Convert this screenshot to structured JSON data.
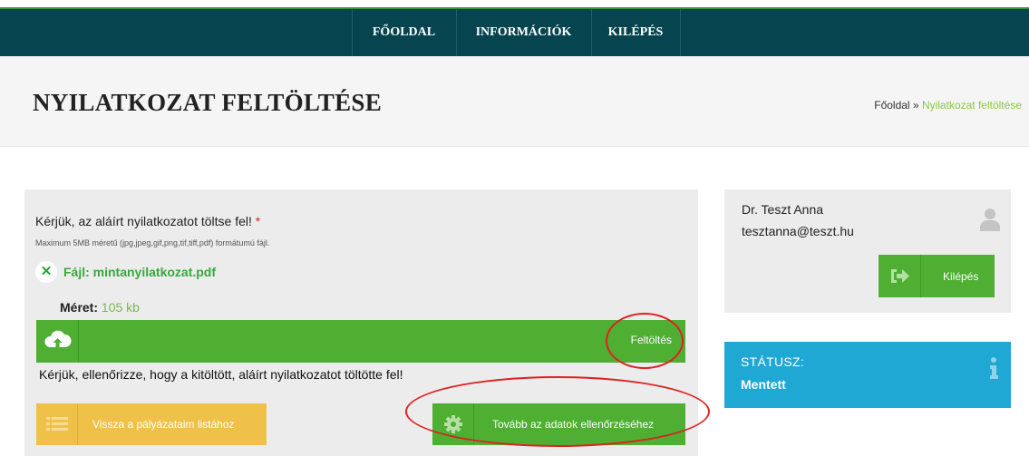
{
  "nav": {
    "items": [
      {
        "label": "FŐOLDAL"
      },
      {
        "label": "INFORMÁCIÓK"
      },
      {
        "label": "KILÉPÉS"
      }
    ]
  },
  "header": {
    "title": "NYILATKOZAT FELTÖLTÉSE",
    "breadcrumb": {
      "home": "Főoldal",
      "separator": " » ",
      "current": "Nyilatkozat feltöltése"
    }
  },
  "upload_form": {
    "label": "Kérjük, az aláírt nyilatkozatot töltse fel!",
    "required_mark": "*",
    "hint": "Maximum 5MB méretű (jpg,jpeg,gif,png,tif,tiff,pdf) formátumú fájl.",
    "file_label": "Fájl: mintanyilatkozat.pdf",
    "remove_icon": "close-icon",
    "size_label": "Méret:",
    "size_value": "105 kb",
    "upload_button": "Feltöltés",
    "upload_icon": "cloud-upload-icon",
    "notice": "Kérjük, ellenőrizze, hogy a kitöltött, aláírt nyilatkozatot töltötte fel!",
    "back_button": "Vissza a pályázataim listához",
    "back_icon": "list-icon",
    "next_button": "Tovább az adatok ellenőrzéséhez",
    "next_icon": "gear-icon"
  },
  "user": {
    "name": "Dr. Teszt Anna",
    "email": "tesztanna@teszt.hu",
    "avatar_icon": "user-icon",
    "logout_button": "Kilépés",
    "logout_icon": "sign-out-icon"
  },
  "status": {
    "title": "STÁTUSZ:",
    "value": "Mentett",
    "icon": "info-icon"
  },
  "colors": {
    "nav_bg": "#06444f",
    "green": "#4eaf32",
    "yellow": "#f0c149",
    "blue": "#20a8d4",
    "annotation_red": "#e02020"
  }
}
